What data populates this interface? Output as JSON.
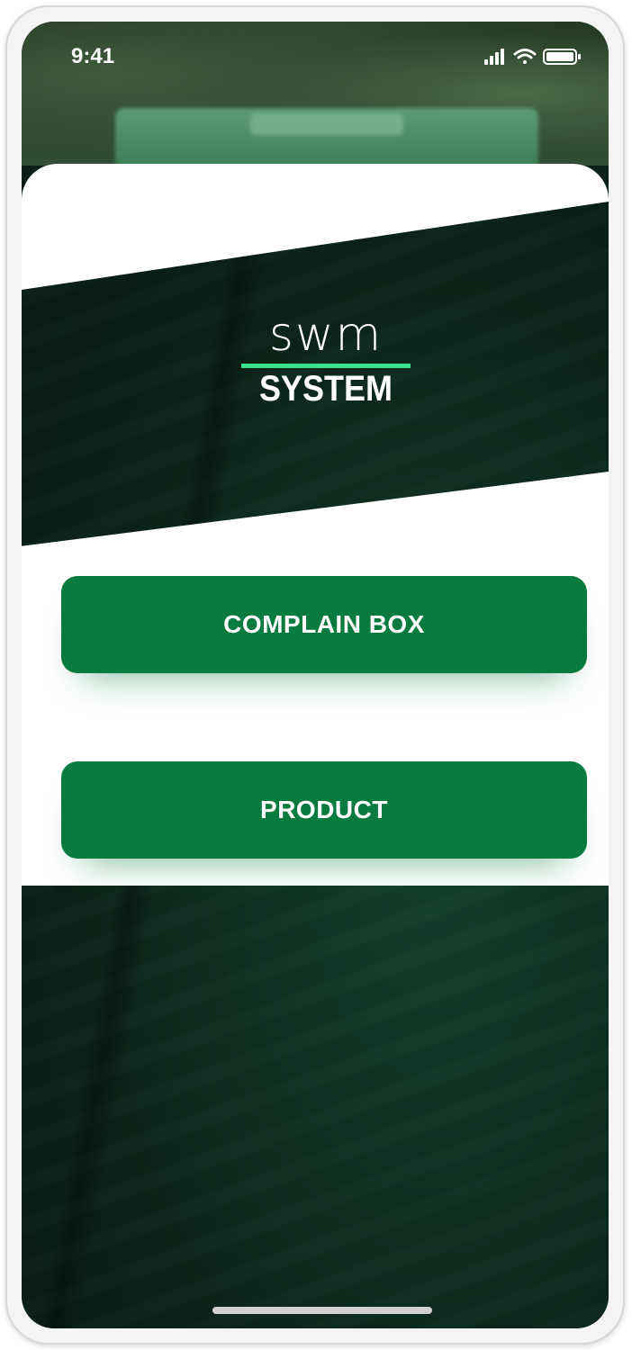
{
  "status_bar": {
    "time": "9:41",
    "signal_icon": "cellular-signal-icon",
    "wifi_icon": "wifi-icon",
    "battery_icon": "battery-icon"
  },
  "logo": {
    "top": "swm",
    "bottom": "SYSTEM",
    "accent_color": "#3be28a"
  },
  "buttons": {
    "complain_box": "COMPLAIN BOX",
    "product": "PRODUCT"
  },
  "colors": {
    "button": "#097b3e",
    "background_dark": "#0b2a1d"
  }
}
